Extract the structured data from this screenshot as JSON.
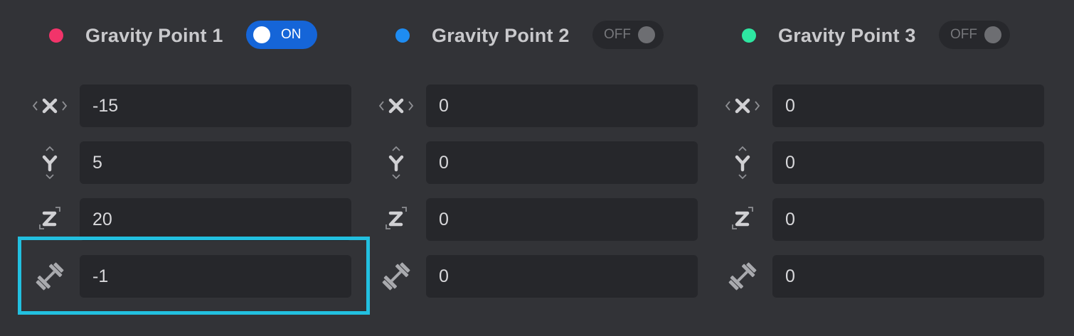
{
  "colors": {
    "point_1": "#f2346a",
    "point_2": "#1e8cf2",
    "point_3": "#2ee6a1",
    "toggle_on": "#1565d8",
    "highlight": "#22c0e0"
  },
  "points": [
    {
      "title": "Gravity Point 1",
      "toggle_label": "ON",
      "enabled": true,
      "x": "-15",
      "y": "5",
      "z": "20",
      "strength": "-1"
    },
    {
      "title": "Gravity Point 2",
      "toggle_label": "OFF",
      "enabled": false,
      "x": "0",
      "y": "0",
      "z": "0",
      "strength": "0"
    },
    {
      "title": "Gravity Point 3",
      "toggle_label": "OFF",
      "enabled": false,
      "x": "0",
      "y": "0",
      "z": "0",
      "strength": "0"
    }
  ],
  "icons": {
    "x": "x-axis-icon",
    "y": "y-axis-icon",
    "z": "z-axis-icon",
    "strength": "dumbbell-icon"
  }
}
